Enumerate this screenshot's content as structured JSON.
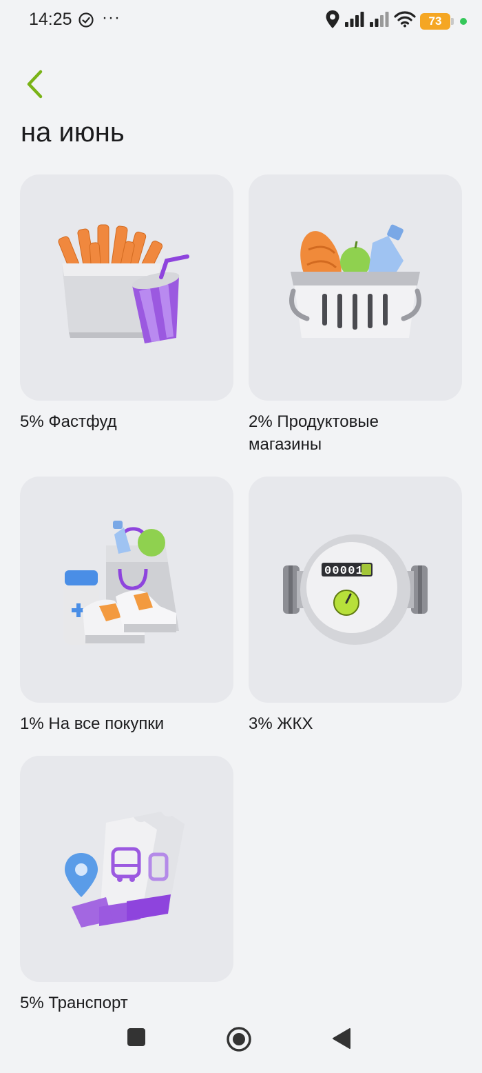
{
  "status_bar": {
    "time": "14:25",
    "dots": "···",
    "battery": "73",
    "icons": [
      "check-circle-icon",
      "location-icon",
      "signal-icon",
      "signal-icon",
      "wifi-icon",
      "battery-icon"
    ]
  },
  "header": {
    "back_icon": "chevron-left-icon",
    "title": "на июнь"
  },
  "colors": {
    "accent": "#7ab317",
    "card_bg": "#e7e8ec",
    "page_bg": "#f2f3f5",
    "battery": "#f5a623"
  },
  "categories": [
    {
      "label": "5% Фастфуд",
      "icon": "fastfood-icon"
    },
    {
      "label": "2% Продуктовые магазины",
      "icon": "grocery-basket-icon"
    },
    {
      "label": "1% На все покупки",
      "icon": "shopping-bag-icon"
    },
    {
      "label": "3% ЖКХ",
      "icon": "water-meter-icon",
      "meter_reading": "00001"
    },
    {
      "label": "5% Транспорт",
      "icon": "transport-ticket-icon"
    }
  ],
  "navigation": {
    "buttons": [
      "recents-button",
      "home-button",
      "back-button"
    ]
  }
}
